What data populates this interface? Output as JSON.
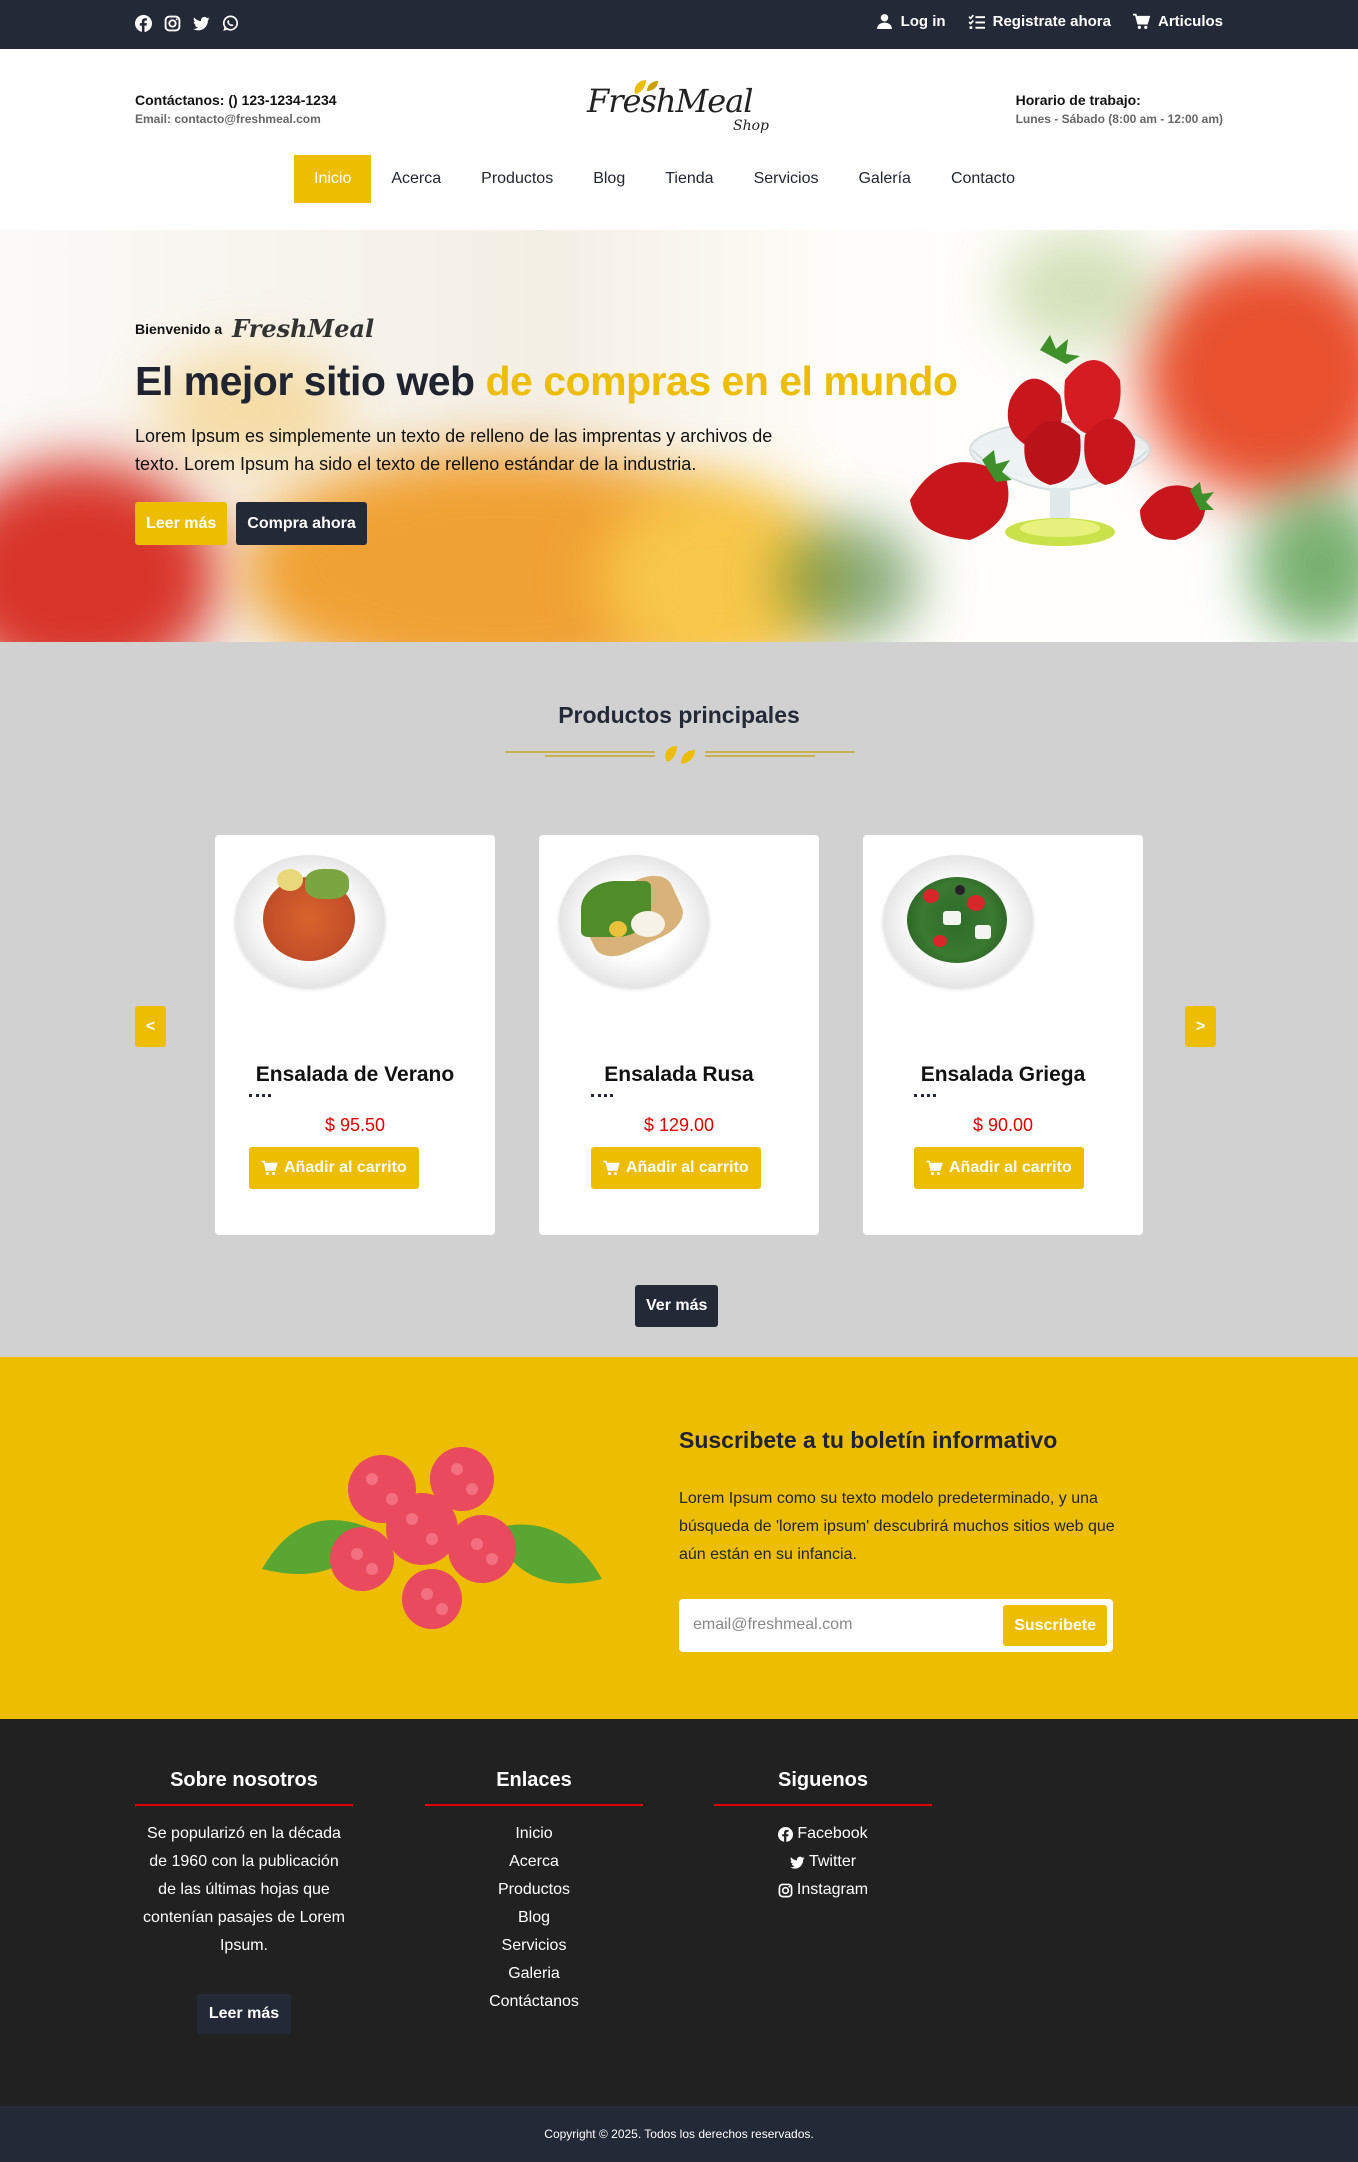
{
  "topbar": {
    "social_icons": [
      "facebook-icon",
      "instagram-icon",
      "twitter-icon",
      "whatsapp-icon"
    ],
    "login": "Log in",
    "register": "Registrate ahora",
    "cart": "Articulos"
  },
  "header": {
    "contact_phone": "Contáctanos: () 123-1234-1234",
    "contact_email": "Email: contacto@freshmeal.com",
    "logo_word": "FreshMeal",
    "logo_shop": "Shop",
    "hours_title": "Horario de trabajo:",
    "hours_value": "Lunes - Sábado (8:00 am - 12:00 am)"
  },
  "nav": {
    "items": [
      "Inicio",
      "Acerca",
      "Productos",
      "Blog",
      "Tienda",
      "Servicios",
      "Galería",
      "Contacto"
    ],
    "active": "Inicio"
  },
  "hero": {
    "welcome": "Bienvenido a",
    "welcome_logo": "FreshMeal",
    "title_part1": "El mejor sitio web ",
    "title_part2": "de compras en el mundo",
    "description": "Lorem Ipsum es simplemente un texto de relleno de las imprentas y archivos de texto. Lorem Ipsum ha sido el texto de relleno estándar de la industria.",
    "btn_read": "Leer más",
    "btn_buy": "Compra ahora"
  },
  "products": {
    "title": "Productos principales",
    "prev": "<",
    "next": ">",
    "items": [
      {
        "name": "Ensalada de Verano",
        "price": "$ 95.50",
        "button": "Añadir al carrito"
      },
      {
        "name": "Ensalada Rusa",
        "price": "$ 129.00",
        "button": "Añadir al carrito"
      },
      {
        "name": "Ensalada Griega",
        "price": "$ 90.00",
        "button": "Añadir al carrito"
      }
    ],
    "more": "Ver más"
  },
  "newsletter": {
    "title": "Suscribete a tu boletín informativo",
    "text": "Lorem Ipsum como su texto modelo predeterminado, y una búsqueda de 'lorem ipsum' descubrirá muchos sitios web que aún están en su infancia.",
    "placeholder": "email@freshmeal.com",
    "button": "Suscribete"
  },
  "footer": {
    "about_title": "Sobre nosotros",
    "about_text": "Se popularizó en la década de 1960 con la publicación de las últimas hojas que contenían pasajes de Lorem Ipsum.",
    "about_btn": "Leer más",
    "links_title": "Enlaces",
    "links": [
      "Inicio",
      "Acerca",
      "Productos",
      "Blog",
      "Servicios",
      "Galeria",
      "Contáctanos"
    ],
    "follow_title": "Siguenos",
    "follow": [
      "Facebook",
      "Twitter",
      "Instagram"
    ],
    "copyright": "Copyright © 2025. Todos los derechos reservados."
  },
  "colors": {
    "accent": "#edbd02",
    "dark": "#232937",
    "price": "#e00000",
    "footer": "#212121"
  }
}
